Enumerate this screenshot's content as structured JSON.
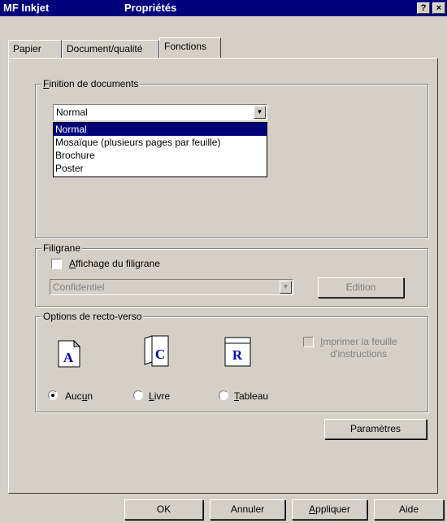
{
  "titlebar": {
    "app": "MF Inkjet",
    "title": "Propriétés",
    "help": "?",
    "close": "×"
  },
  "tabs": [
    {
      "label": "Papier"
    },
    {
      "label": "Document/qualité"
    },
    {
      "label": "Fonctions",
      "active": true
    }
  ],
  "finishing": {
    "legend_accel": "F",
    "legend_rest": "inition de documents",
    "combo_value": "Normal",
    "options": [
      "Normal",
      "Mosaïque (plusieurs pages par feuille)",
      "Brochure",
      "Poster"
    ],
    "selected_index": 0
  },
  "watermark": {
    "legend": "Filigrane",
    "checkbox_accel": "A",
    "checkbox_rest": "ffichage du filigrane",
    "checked": false,
    "combo_value": "Confidentiel",
    "edit_button": "Edition"
  },
  "duplex": {
    "legend": "Options de recto-verso",
    "print_instructions_accel": "I",
    "print_instructions_line1_rest": "mprimer la feuille",
    "print_instructions_line2": "d'instructions",
    "none_pre": "Auc",
    "none_accel": "u",
    "none_post": "n",
    "book_accel": "L",
    "book_rest": "ivre",
    "table_accel": "T",
    "table_rest": "ableau",
    "selected": "none",
    "icon_letters": {
      "none": "A",
      "book": "C",
      "table": "R"
    }
  },
  "params_button": "Paramètres",
  "footer": {
    "ok": "OK",
    "cancel": "Annuler",
    "apply_accel": "A",
    "apply_rest": "ppliquer",
    "help": "Aide"
  },
  "colors": {
    "title_bg": "#00007b",
    "face": "#d4d0c8",
    "selection": "#00007b"
  }
}
